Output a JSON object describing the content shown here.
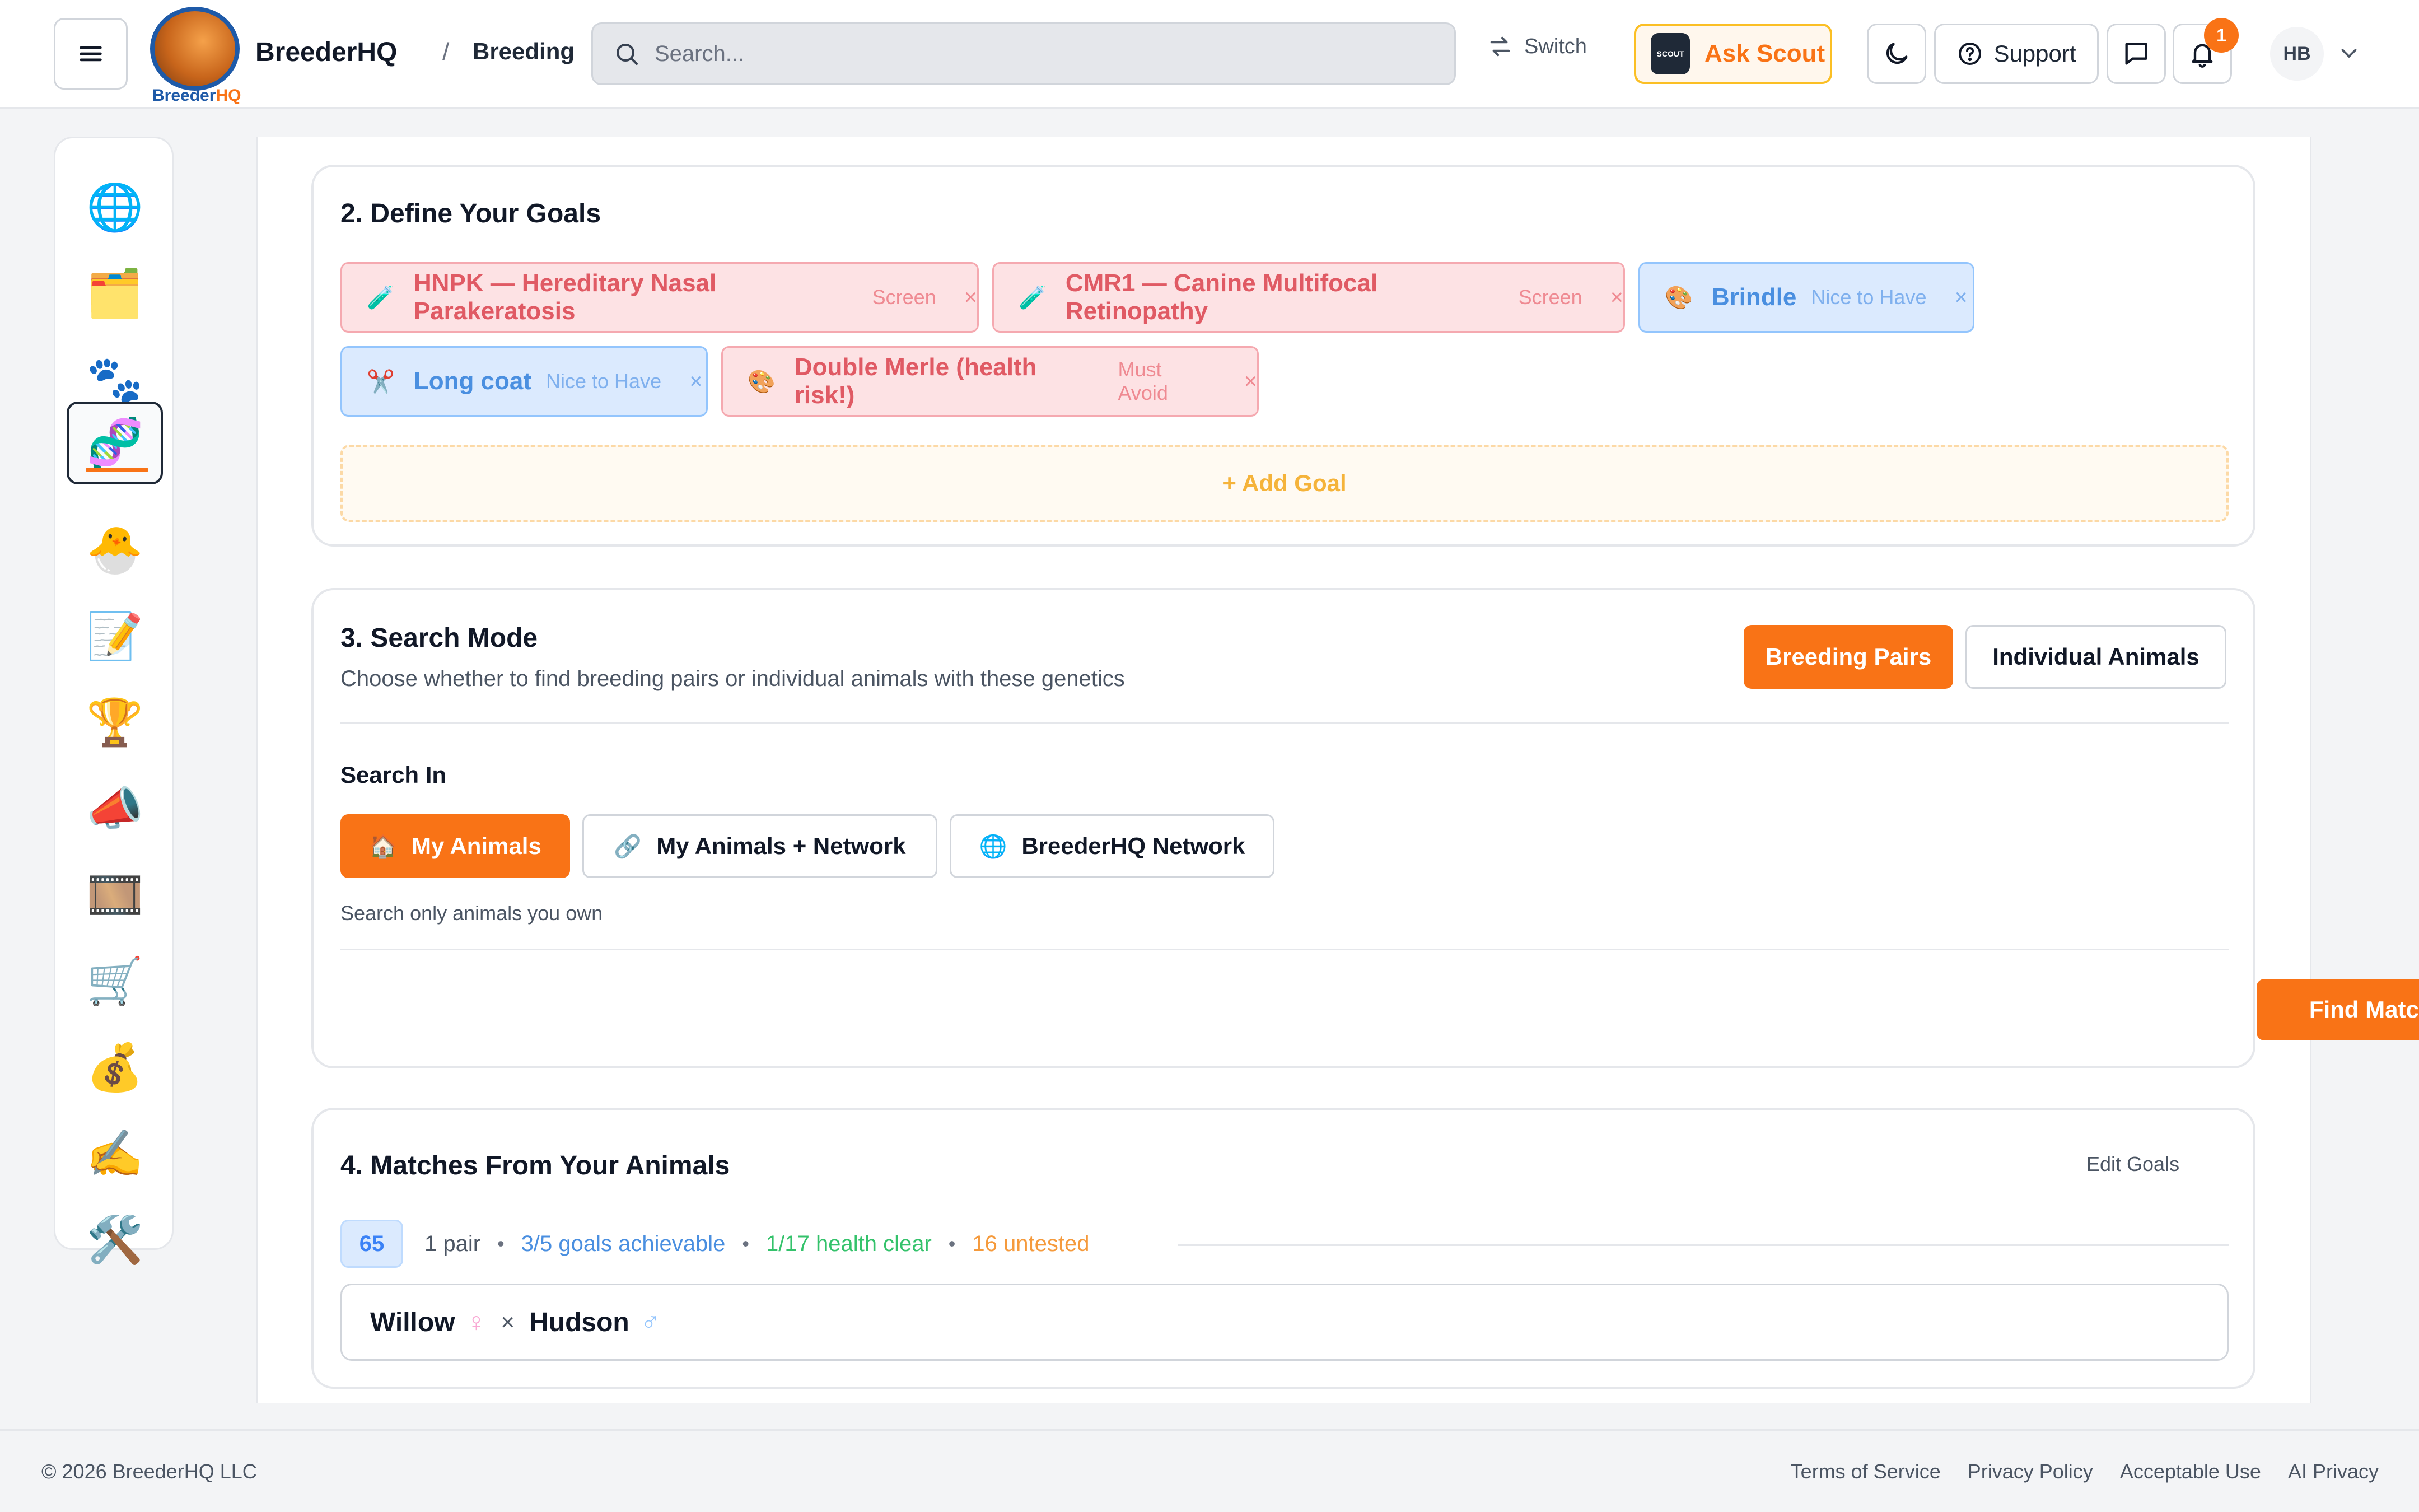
{
  "header": {
    "brand": "BreederHQ",
    "logo_text_a": "Breeder",
    "logo_text_b": "HQ",
    "breadcrumb_sep": "/",
    "breadcrumb": "Breeding",
    "search_placeholder": "Search...",
    "switch_label": "Switch",
    "ask_scout_label": "Ask Scout",
    "scout_badge": "SCOUT",
    "support_label": "Support",
    "notification_count": "1",
    "avatar_initials": "HB"
  },
  "sidebar": {
    "items": [
      {
        "icon": "🌐",
        "name": "globe-icon"
      },
      {
        "icon": "🗂️",
        "name": "card-box-icon"
      },
      {
        "icon": "🐾",
        "name": "paw-icon"
      },
      {
        "icon": "🧬",
        "name": "dna-icon",
        "active": true
      },
      {
        "icon": "🐣",
        "name": "hatching-chick-icon"
      },
      {
        "icon": "📝",
        "name": "memo-icon"
      },
      {
        "icon": "🏆",
        "name": "trophy-icon"
      },
      {
        "icon": "📣",
        "name": "megaphone-icon"
      },
      {
        "icon": "🎞️",
        "name": "film-icon"
      },
      {
        "icon": "🛒",
        "name": "cart-icon"
      },
      {
        "icon": "💰",
        "name": "money-bag-icon"
      },
      {
        "icon": "✍️",
        "name": "writing-hand-icon"
      },
      {
        "icon": "🛠️",
        "name": "tools-icon"
      }
    ]
  },
  "goals": {
    "title": "2. Define Your Goals",
    "chips": [
      {
        "icon": "🧪",
        "label": "HNPK — Hereditary Nasal Parakeratosis",
        "tag": "Screen",
        "color": "red"
      },
      {
        "icon": "🧪",
        "label": "CMR1 — Canine Multifocal Retinopathy",
        "tag": "Screen",
        "color": "red"
      },
      {
        "icon": "🎨",
        "label": "Brindle",
        "tag": "Nice to Have",
        "color": "blue"
      },
      {
        "icon": "✂️",
        "label": "Long coat",
        "tag": "Nice to Have",
        "color": "blue"
      },
      {
        "icon": "🎨",
        "label": "Double Merle (health risk!)",
        "tag": "Must Avoid",
        "color": "red"
      }
    ],
    "remove_glyph": "×",
    "add_goal": "+ Add Goal"
  },
  "mode": {
    "title": "3. Search Mode",
    "description": "Choose whether to find breeding pairs or individual animals with these genetics",
    "breeding_pairs": "Breeding Pairs",
    "individual_animals": "Individual Animals",
    "search_in_label": "Search In",
    "sources": [
      {
        "icon": "🏠",
        "label": "My Animals"
      },
      {
        "icon": "🔗",
        "label": "My Animals + Network"
      },
      {
        "icon": "🌐",
        "label": "BreederHQ Network"
      }
    ],
    "hint": "Search only animals you own",
    "find_matches": "Find Matches"
  },
  "matches": {
    "title": "4. Matches From Your Animals",
    "edit_goals": "Edit Goals",
    "count": "65",
    "pair_count": "1 pair",
    "goals_achievable": "3/5 goals achievable",
    "health_clear": "1/17 health clear",
    "untested": "16 untested",
    "dot": "•",
    "pair": {
      "dam": "Willow",
      "dam_sym": "♀",
      "sire": "Hudson",
      "sire_sym": "♂",
      "times": "×"
    }
  },
  "footer": {
    "copyright": "© 2026 BreederHQ LLC",
    "links": [
      "Terms of Service",
      "Privacy Policy",
      "Acceptable Use",
      "AI Privacy"
    ]
  },
  "colors": {
    "accent": "#f97316",
    "goal_blue": "#3b82f6",
    "health_green": "#22c55e",
    "untested_orange": "#f97316"
  }
}
